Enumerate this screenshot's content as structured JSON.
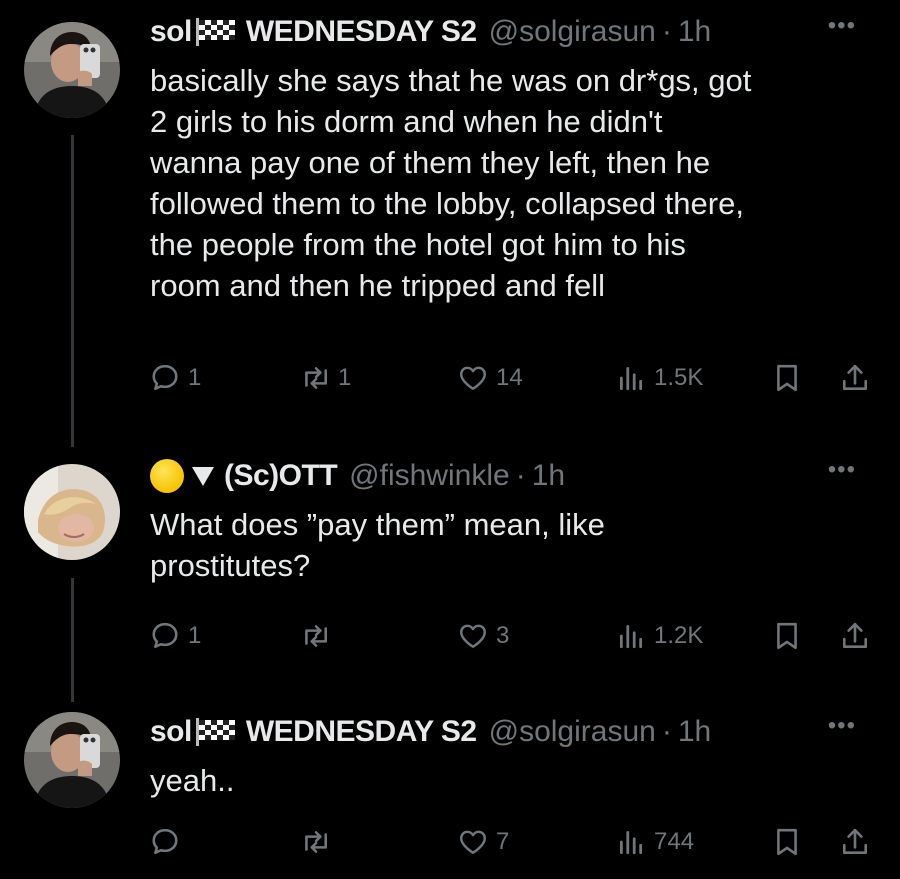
{
  "tweets": [
    {
      "name": "sol",
      "name_suffix": "WEDNESDAY S2",
      "handle": "@solgirasun",
      "time": "1h",
      "text": "basically she says that he was on dr*gs, got\n2 girls to his dorm and when he didn't\nwanna pay one of them they left, then he\nfollowed them to the lobby, collapsed there,\nthe people from the hotel got him to his\nroom and then he tripped and fell",
      "replies": "1",
      "reposts": "1",
      "likes": "14",
      "views": "1.5K"
    },
    {
      "name": "(Sc)OTT",
      "handle": "@fishwinkle",
      "time": "1h",
      "text": "What does ”pay them” mean, like\nprostitutes?",
      "replies": "1",
      "reposts": "",
      "likes": "3",
      "views": "1.2K"
    },
    {
      "name": "sol",
      "name_suffix": "WEDNESDAY S2",
      "handle": "@solgirasun",
      "time": "1h",
      "text": "yeah..",
      "replies": "",
      "reposts": "",
      "likes": "7",
      "views": "744"
    }
  ],
  "ui": {
    "dot": "·",
    "more": "•••"
  },
  "colors": {
    "background": "#000000",
    "text": "#e7e9ea",
    "muted": "#71767b",
    "thread_line": "#333639"
  },
  "icons": [
    "reply-icon",
    "repost-icon",
    "like-icon",
    "views-icon",
    "bookmark-icon",
    "share-icon",
    "checkered-flag-icon",
    "more-icon"
  ]
}
